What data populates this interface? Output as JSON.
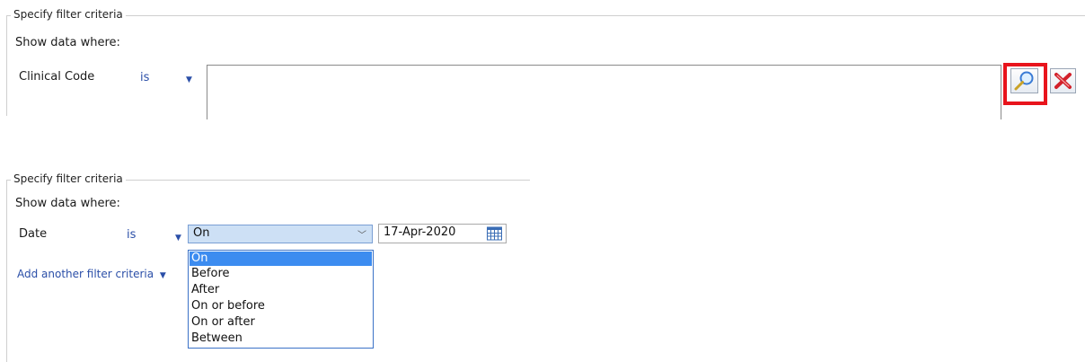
{
  "top_panel": {
    "legend": "Specify filter criteria",
    "show_data_where": "Show data where:",
    "field_label": "Clinical Code",
    "operator": "is",
    "lookup_icon": "magnifier-icon",
    "clear_icon": "red-x-icon"
  },
  "bottom_panel": {
    "legend": "Specify filter criteria",
    "show_data_where": "Show data where:",
    "field_label": "Date",
    "operator": "is",
    "selected_option": "On",
    "date_value": "17-Apr-2020",
    "calendar_icon": "calendar-icon",
    "add_criteria": "Add another filter criteria",
    "options": [
      "On",
      "Before",
      "After",
      "On or before",
      "On or after",
      "Between"
    ]
  },
  "colors": {
    "highlight": "#e8141c",
    "selection": "#3c8cf0",
    "operator": "#2b4fa8"
  }
}
